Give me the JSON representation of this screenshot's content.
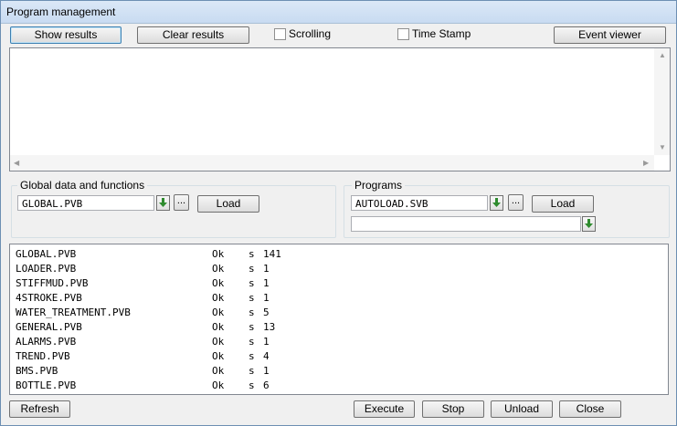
{
  "window": {
    "title": "Program management"
  },
  "toolbar": {
    "show_results": "Show results",
    "clear_results": "Clear results",
    "scrolling_label": "Scrolling",
    "scrolling_checked": false,
    "timestamp_label": "Time Stamp",
    "timestamp_checked": false,
    "event_viewer": "Event viewer"
  },
  "global_group": {
    "label": "Global data and functions",
    "file_value": "GLOBAL.PVB",
    "browse_label": "...",
    "load_label": "Load"
  },
  "programs_group": {
    "label": "Programs",
    "file_value": "AUTOLOAD.SVB",
    "browse_label": "...",
    "load_label": "Load",
    "second_value": ""
  },
  "results": {
    "rows": [
      {
        "name": "GLOBAL.PVB",
        "status": "Ok",
        "s": "s",
        "n": "141"
      },
      {
        "name": "LOADER.PVB",
        "status": "Ok",
        "s": "s",
        "n": "1"
      },
      {
        "name": "STIFFMUD.PVB",
        "status": "Ok",
        "s": "s",
        "n": "1"
      },
      {
        "name": "4STROKE.PVB",
        "status": "Ok",
        "s": "s",
        "n": "1"
      },
      {
        "name": "WATER_TREATMENT.PVB",
        "status": "Ok",
        "s": "s",
        "n": "5"
      },
      {
        "name": "GENERAL.PVB",
        "status": "Ok",
        "s": "s",
        "n": "13"
      },
      {
        "name": "ALARMS.PVB",
        "status": "Ok",
        "s": "s",
        "n": "1"
      },
      {
        "name": "TREND.PVB",
        "status": "Ok",
        "s": "s",
        "n": "4"
      },
      {
        "name": "BMS.PVB",
        "status": "Ok",
        "s": "s",
        "n": "1"
      },
      {
        "name": "BOTTLE.PVB",
        "status": "Ok",
        "s": "s",
        "n": "6"
      }
    ]
  },
  "footer": {
    "refresh": "Refresh",
    "execute": "Execute",
    "stop": "Stop",
    "unload": "Unload",
    "close": "Close"
  },
  "icons": {
    "download_arrow": "green-down-arrow-icon"
  },
  "colors": {
    "accent": "#2e8b2e",
    "title_bg": "#dbe8f7"
  }
}
